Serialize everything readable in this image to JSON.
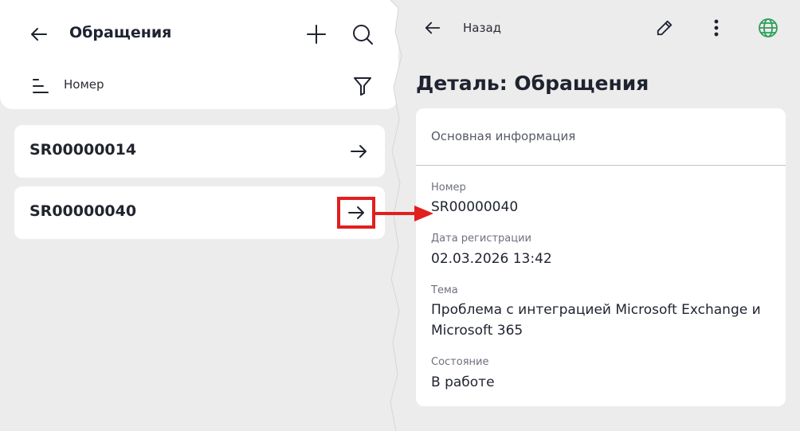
{
  "list_panel": {
    "title": "Обращения",
    "sort_label": "Номер",
    "icons": {
      "back": "arrow-left-icon",
      "add": "plus-icon",
      "search": "search-icon",
      "sort": "sort-lines-icon",
      "filter": "funnel-icon"
    },
    "items": [
      {
        "number": "SR00000014",
        "icon": "arrow-right-icon"
      },
      {
        "number": "SR00000040",
        "icon": "arrow-right-icon",
        "highlighted": true
      }
    ]
  },
  "detail_panel": {
    "back_label": "Назад",
    "page_title": "Деталь: Обращения",
    "icons": {
      "back": "arrow-left-icon",
      "edit": "pencil-icon",
      "more": "more-vertical-icon",
      "language": "globe-icon"
    },
    "section_title": "Основная информация",
    "fields": {
      "number": {
        "label": "Номер",
        "value": "SR00000040"
      },
      "reg_date": {
        "label": "Дата регистрации",
        "value": "02.03.2026 13:42"
      },
      "subject": {
        "label": "Тема",
        "value": "Проблема с интеграцией Microsoft Exchange и Microsoft 365"
      },
      "status": {
        "label": "Состояние",
        "value": "В работе"
      }
    }
  },
  "colors": {
    "annotation": "#e21e1e",
    "globe": "#2f9e5b",
    "background": "#ececec",
    "card": "#ffffff"
  }
}
